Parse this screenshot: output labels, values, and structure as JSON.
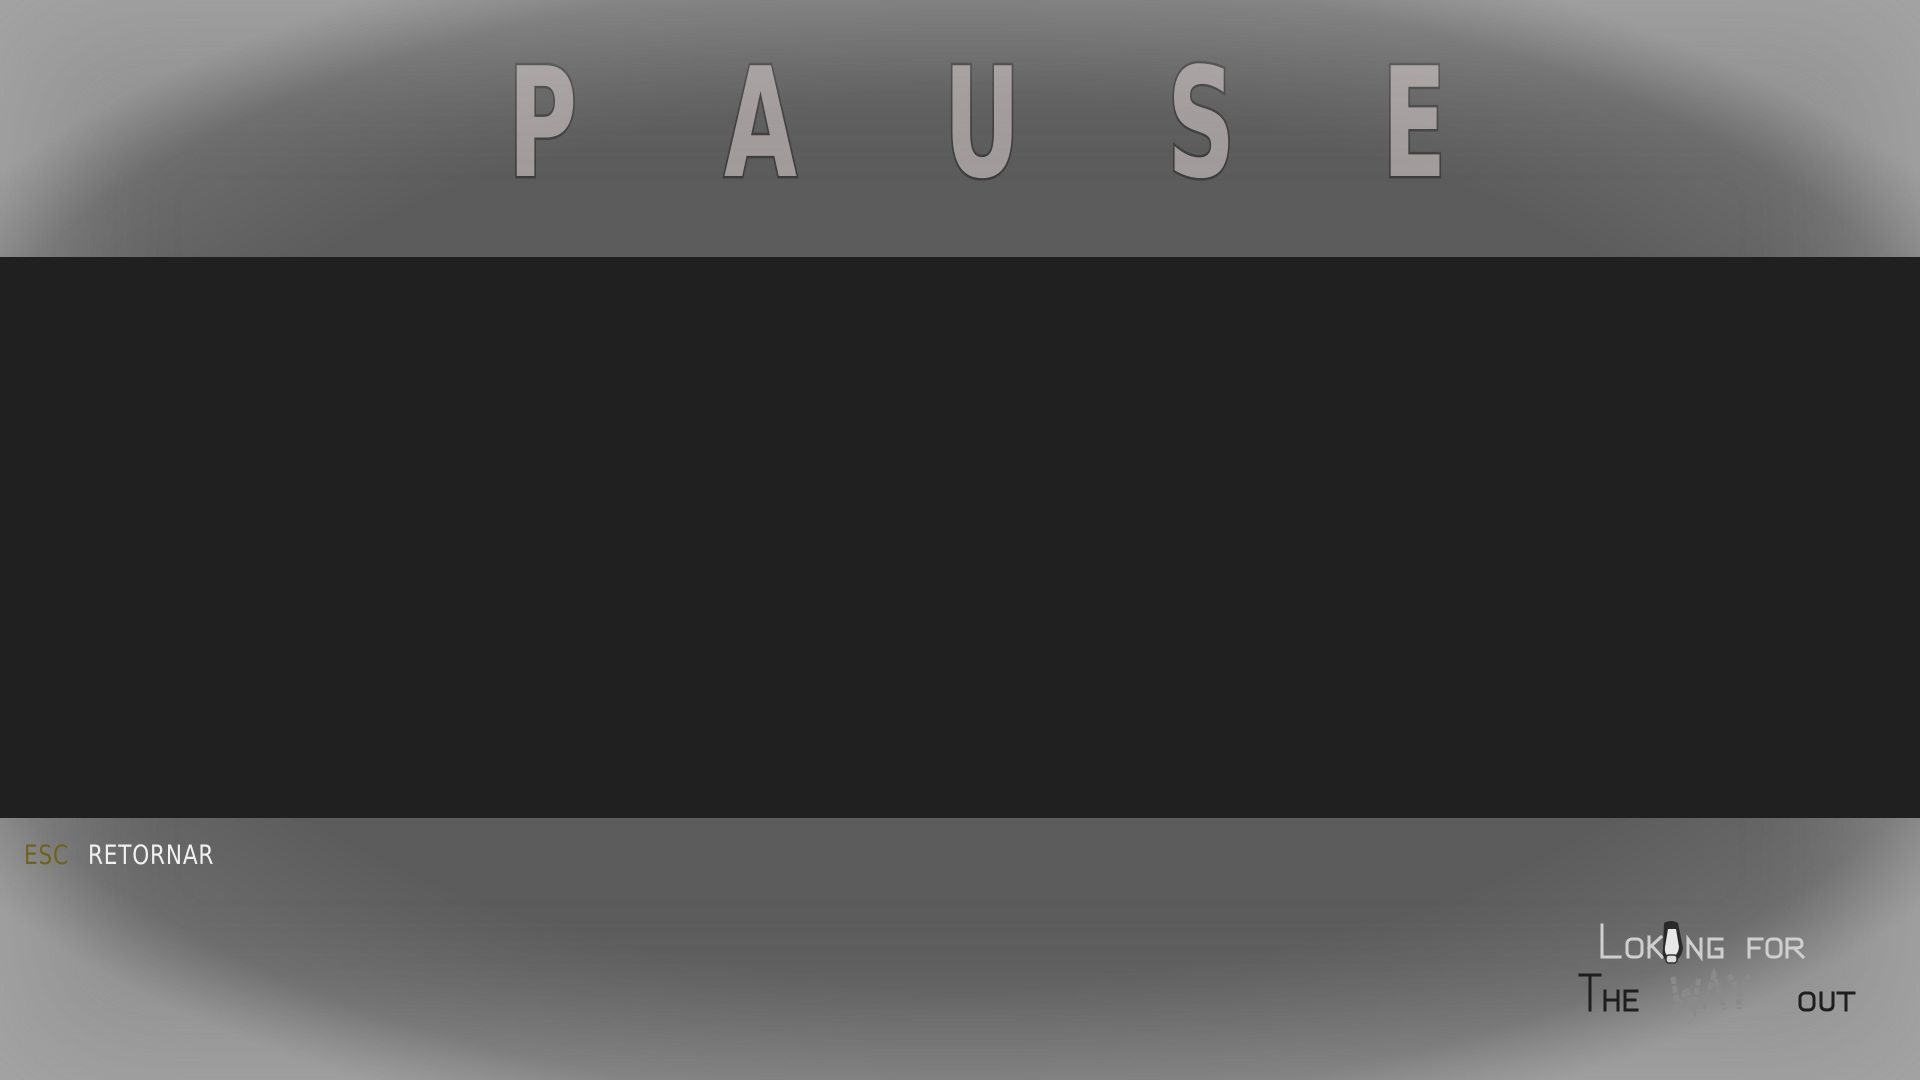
{
  "screen": {
    "title": "P A U S E"
  },
  "hints": [
    {
      "key": "ESC",
      "action": "RETORNAR"
    }
  ],
  "logo": {
    "line1": "Looking for",
    "line2": "The WAY out"
  },
  "colors": {
    "background": "#5c5c5c",
    "panel": "#202020",
    "title_fill": "#a29b9b",
    "key_hint": "#6e6419",
    "action_text": "#f1f1f1"
  }
}
